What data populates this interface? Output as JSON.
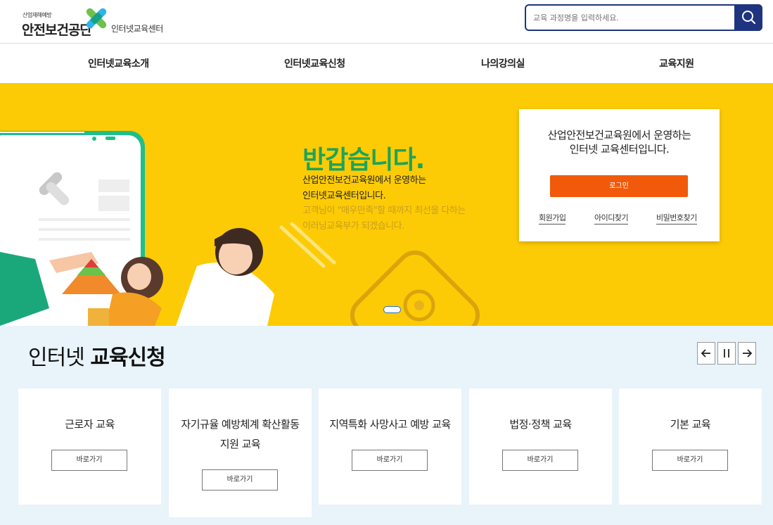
{
  "header": {
    "logo_small": "산업재해예방",
    "logo_main": "안전보건공단",
    "logo_sub": "인터넷교육센터",
    "search_placeholder": "교육 과정명을 입력하세요."
  },
  "nav": {
    "items": [
      "인터넷교육소개",
      "인터넷교육신청",
      "나의강의실",
      "교육지원"
    ]
  },
  "hero": {
    "title": "반갑습니다.",
    "lines": [
      "산업안전보건교육원에서 운영하는",
      "인터넷교육센터입니다.",
      "고객님이 \"매우만족\"할 때까지 최선을 다하는",
      "이러닝교육부가 되겠습니다."
    ]
  },
  "login": {
    "text_line1": "산업안전보건교육원에서 운영하는",
    "text_line2": "인터넷 교육센터입니다.",
    "button": "로그인",
    "links": [
      "회원가입",
      "아이디찾기",
      "비밀번호찾기"
    ]
  },
  "apply": {
    "title_normal": "인터넷",
    "title_bold": "교육신청",
    "controls": [
      "prev",
      "pause",
      "next"
    ],
    "cards": [
      {
        "title": "근로자 교육",
        "button": "바로가기"
      },
      {
        "title": "자기규율 예방체계 확산활동 지원 교육",
        "title_line1": "자기규율 예방체계 확산활동",
        "title_line2": "지원 교육",
        "button": "바로가기"
      },
      {
        "title": "지역특화 사망사고 예방 교육",
        "button": "바로가기"
      },
      {
        "title": "법정·정책 교육",
        "button": "바로가기"
      },
      {
        "title": "기본 교육",
        "button": "바로가기"
      }
    ]
  },
  "colors": {
    "brand_navy": "#1e3480",
    "hero_yellow": "#fccb05",
    "hero_green": "#1ea35a",
    "login_orange": "#f05a0a",
    "section_bg": "#e8f3fa"
  }
}
